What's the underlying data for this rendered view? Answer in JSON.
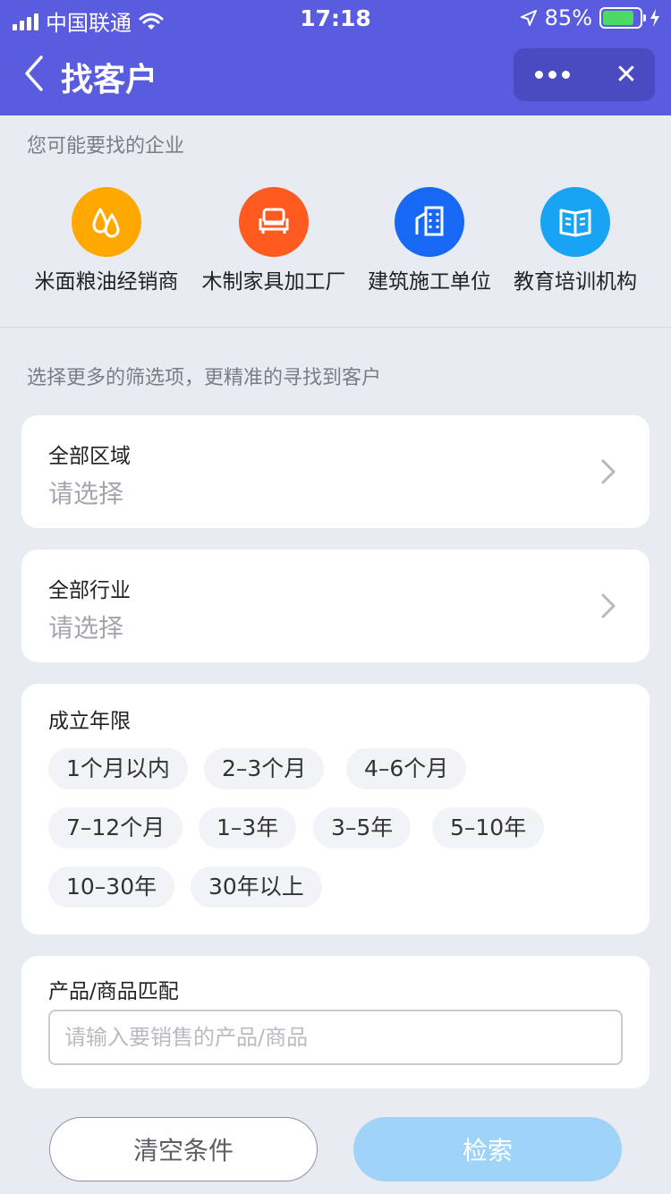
{
  "status_bar": {
    "carrier": "中国联通",
    "time": "17:18",
    "battery": "85%"
  },
  "nav": {
    "title": "找客户"
  },
  "suggest": {
    "hint": "您可能要找的企业",
    "items": [
      {
        "label": "米面粮油经销商",
        "icon": "oil-drops-icon",
        "color": "#ffa800"
      },
      {
        "label": "木制家具加工厂",
        "icon": "sofa-icon",
        "color": "#ff5a1f"
      },
      {
        "label": "建筑施工单位",
        "icon": "building-icon",
        "color": "#1668f5"
      },
      {
        "label": "教育培训机构",
        "icon": "book-icon",
        "color": "#19a3f5"
      }
    ]
  },
  "filter": {
    "hint": "选择更多的筛选项，更精准的寻找到客户",
    "region": {
      "title": "全部区域",
      "value": "请选择"
    },
    "industry": {
      "title": "全部行业",
      "value": "请选择"
    },
    "age": {
      "title": "成立年限",
      "options": [
        "1个月以内",
        "2–3个月",
        "4–6个月",
        "7–12个月",
        "1–3年",
        "3–5年",
        "5–10年",
        "10–30年",
        "30年以上"
      ]
    },
    "product": {
      "title": "产品/商品匹配",
      "placeholder": "请输入要销售的产品/商品"
    }
  },
  "actions": {
    "clear_label": "清空条件",
    "search_label": "检索"
  }
}
